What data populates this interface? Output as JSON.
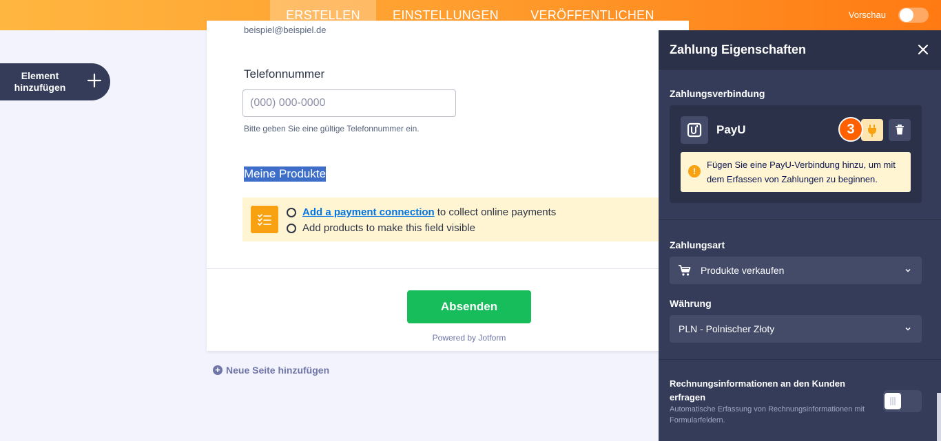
{
  "topbar": {
    "tabs": [
      {
        "label": "ERSTELLEN"
      },
      {
        "label": "EINSTELLUNGEN"
      },
      {
        "label": "VERÖFFENTLICHEN"
      }
    ],
    "preview_label": "Vorschau",
    "preview_enabled": false
  },
  "add_element": {
    "label": "Element hinzufügen",
    "icon": "plus-icon"
  },
  "form": {
    "email_sublabel": "beispiel@beispiel.de",
    "phone_label": "Telefonnummer",
    "phone_placeholder": "(000) 000-0000",
    "phone_sublabel": "Bitte geben Sie eine gültige Telefonnummer ein.",
    "products_label": "Meine Produkte",
    "notice": {
      "icon": "checklist-icon",
      "item1_link": "Add a payment connection",
      "item1_text": "to collect online payments",
      "item2_text": "Add products to make this field visible",
      "color": "#fff5d3"
    },
    "submit_label": "Absenden",
    "powered_by": "Powered by Jotform"
  },
  "add_page": {
    "label": "Neue Seite hinzufügen",
    "icon": "plus-circle-icon"
  },
  "panel": {
    "title": "Zahlung Eigenschaften",
    "close_icon": "close-icon",
    "connection": {
      "section_label": "Zahlungsverbindung",
      "gateway_name": "PayU",
      "step_badge": "3",
      "tooltip": "Fügen Sie eine PayU-Verbindung hinzu, um mit dem Erfassen von Zahlungen zu beginnen.",
      "tooltip_icon": "warning-icon",
      "connect_icon": "plug-icon",
      "delete_icon": "trash-icon"
    },
    "payment_type": {
      "label": "Zahlungsart",
      "value": "Produkte verkaufen",
      "icon": "cart-icon"
    },
    "currency": {
      "label": "Währung",
      "value": "PLN - Polnischer Złoty"
    },
    "billing": {
      "title": "Rechnungsinformationen an den Kunden erfragen",
      "description": "Automatische Erfassung von Rechnungsinformationen mit Formularfeldern.",
      "enabled": false
    }
  },
  "colors": {
    "accent": "#ff7a12",
    "panel": "#343c5a",
    "submit": "#18bd5b",
    "step_badge": "#ff6100"
  }
}
